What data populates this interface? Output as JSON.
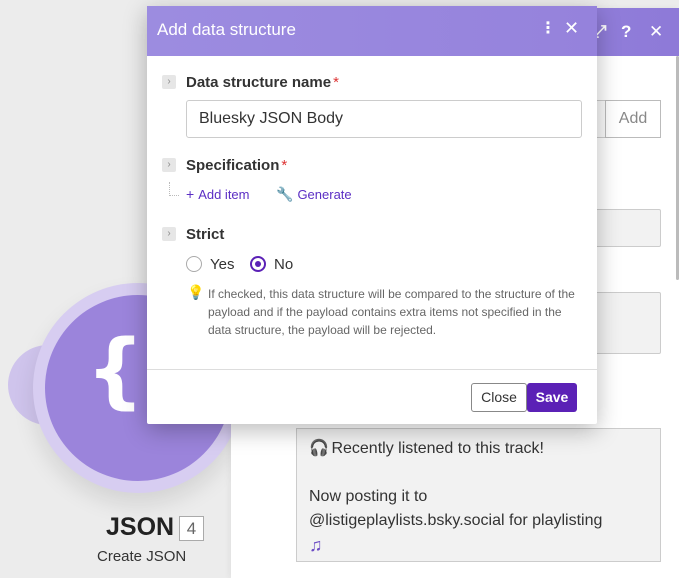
{
  "colors": {
    "accent": "#5b21b6",
    "header_purple": "#9582dc",
    "node_purple": "#9b84db",
    "required": "#dd3333"
  },
  "module": {
    "glyph": "{",
    "title": "JSON",
    "badge": "4",
    "subtitle": "Create JSON"
  },
  "panel": {
    "header_icons": [
      "resize-icon",
      "help-icon",
      "close-icon"
    ],
    "help_glyph": "?",
    "close_glyph": "✕",
    "add_label": "Add",
    "textarea": {
      "line1": "Recently listened to this track!",
      "line2": "Now posting it to",
      "line3": "@listigeplaylists.bsky.social for playlisting",
      "emoji": "♫"
    }
  },
  "dialog": {
    "title": "Add data structure",
    "name_label": "Data structure name",
    "name_value": "Bluesky JSON Body",
    "spec_label": "Specification",
    "required_mark": "*",
    "add_item_label": "Add item",
    "generate_label": "Generate",
    "strict_label": "Strict",
    "strict_options": [
      "Yes",
      "No"
    ],
    "strict_selected": "No",
    "hint": "If checked, this data structure will be compared to the structure of the payload and if the payload contains extra items not specified in the data structure, the payload will be rejected.",
    "close_label": "Close",
    "save_label": "Save"
  }
}
